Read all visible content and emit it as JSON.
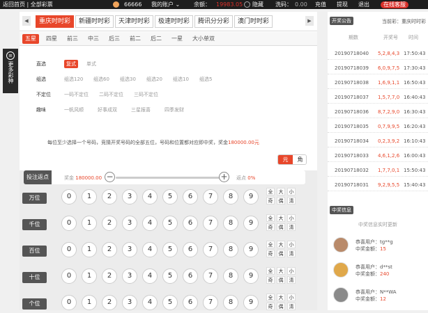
{
  "topbar": {
    "home": "返回首页 | 全部彩票",
    "user_id": "66666",
    "account_menu": "我的账户",
    "balance_label": "余额：",
    "balance_value": "19983.05",
    "hide": "隐藏",
    "points_label": "洗码：",
    "points_value": "0.00",
    "recharge": "充值",
    "withdraw": "提现",
    "logout": "退出",
    "cs_button": "在线客服"
  },
  "left_rail": {
    "icon": "menu-icon",
    "label": "更多彩种"
  },
  "tabs": [
    {
      "label": "重庆时时彩",
      "active": true
    },
    {
      "label": "新疆时时彩",
      "active": false
    },
    {
      "label": "天津时时彩",
      "active": false
    },
    {
      "label": "极速时时彩",
      "active": false
    },
    {
      "label": "腾讯分分彩",
      "active": false
    },
    {
      "label": "澳门时时彩",
      "active": false
    }
  ],
  "subtabs": [
    {
      "label": "五星",
      "active": true
    },
    {
      "label": "四星",
      "active": false
    },
    {
      "label": "前三",
      "active": false
    },
    {
      "label": "中三",
      "active": false
    },
    {
      "label": "后三",
      "active": false
    },
    {
      "label": "前二",
      "active": false
    },
    {
      "label": "后二",
      "active": false
    },
    {
      "label": "一星",
      "active": false
    },
    {
      "label": "大小单双",
      "active": false
    }
  ],
  "rules": [
    {
      "label": "直选",
      "options": [
        "复式",
        "单式"
      ],
      "active": 0
    },
    {
      "label": "组选",
      "options": [
        "组选120",
        "组选60",
        "组选30",
        "组选20",
        "组选10",
        "组选5"
      ],
      "active": -1
    },
    {
      "label": "不定位",
      "options": [
        "一码不定位",
        "二码不定位",
        "三码不定位"
      ],
      "active": -1
    },
    {
      "label": "趣味",
      "options": [
        "一帆风顺",
        "好事成双",
        "三星报喜",
        "四季发财"
      ],
      "active": -1
    }
  ],
  "description": {
    "text": "每位至少选择一个号码，竞猜开奖号码的全部五位，号码和位置都对应即中奖，奖金",
    "amount": "180000.00元"
  },
  "mode_toggle": {
    "on": "元",
    "off": "角"
  },
  "rebate": {
    "button": "投注返点",
    "left_text": "奖金",
    "left_value": "180000.00",
    "minus": "−",
    "plus": "+",
    "right_text": "返点",
    "right_value": "0%"
  },
  "positions": [
    {
      "label": "万位"
    },
    {
      "label": "千位"
    },
    {
      "label": "百位"
    },
    {
      "label": "十位"
    },
    {
      "label": "个位"
    }
  ],
  "balls": [
    "0",
    "1",
    "2",
    "3",
    "4",
    "5",
    "6",
    "7",
    "8",
    "9"
  ],
  "quick": [
    "全",
    "大",
    "小",
    "奇",
    "偶",
    "清"
  ],
  "results": {
    "badge": "开奖公告",
    "selector": "当前彩：重庆时时彩",
    "col_issue": "期数",
    "col_number": "开奖号",
    "col_time": "时间",
    "rows": [
      {
        "issue": "20190718040",
        "number": "5,2,8,4,3",
        "time": "17:50:43"
      },
      {
        "issue": "20190718039",
        "number": "6,0,9,7,5",
        "time": "17:30:43"
      },
      {
        "issue": "20190718038",
        "number": "1,6,9,1,1",
        "time": "16:50:43"
      },
      {
        "issue": "20190718037",
        "number": "1,5,7,7,0",
        "time": "16:40:43"
      },
      {
        "issue": "20190718036",
        "number": "8,7,2,9,0",
        "time": "16:30:43"
      },
      {
        "issue": "20190718035",
        "number": "0,7,9,9,5",
        "time": "16:20:43"
      },
      {
        "issue": "20190718034",
        "number": "0,2,3,9,2",
        "time": "16:10:43"
      },
      {
        "issue": "20190718033",
        "number": "4,6,1,2,6",
        "time": "16:00:43"
      },
      {
        "issue": "20190718032",
        "number": "1,7,7,0,1",
        "time": "15:50:43"
      },
      {
        "issue": "20190718031",
        "number": "9,2,9,5,5",
        "time": "15:40:43"
      }
    ]
  },
  "winners": {
    "badge": "中奖信息",
    "title": "中奖信息实时更新",
    "items": [
      {
        "name": "tg**g",
        "amount": "15"
      },
      {
        "name": "d**st",
        "amount": "240"
      },
      {
        "name": "N**WA",
        "amount": "12"
      }
    ],
    "name_prefix": "恭喜用户：",
    "amount_prefix": "中奖金额："
  }
}
